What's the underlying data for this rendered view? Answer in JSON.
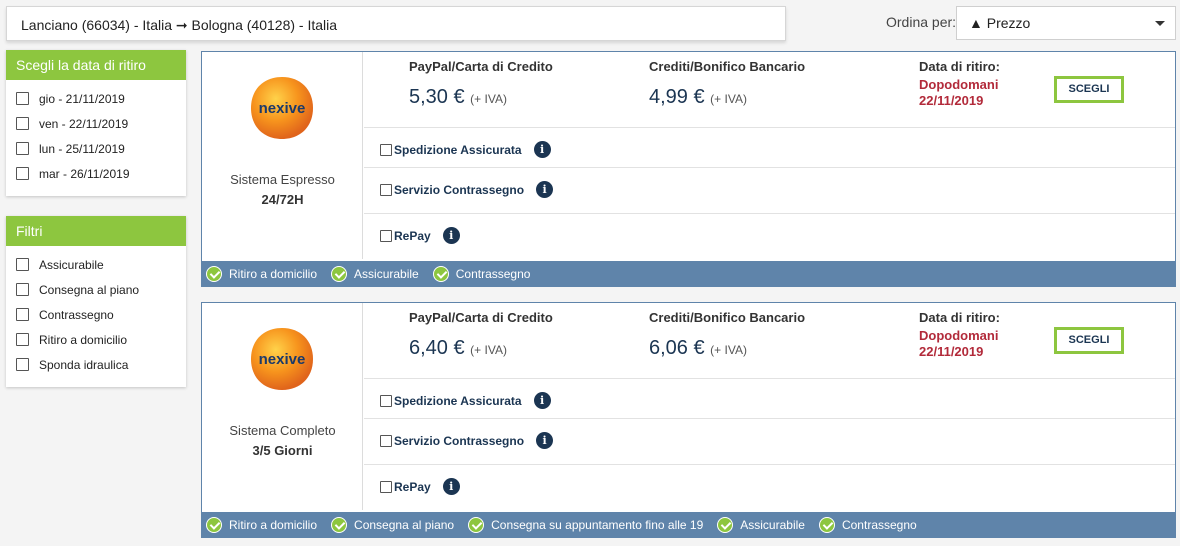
{
  "header": {
    "route": "Lanciano (66034) - Italia ➞ Bologna (40128) - Italia",
    "sort_label": "Ordina per:",
    "sort_value": "▲ Prezzo"
  },
  "date_panel": {
    "title": "Scegli la data di ritiro",
    "options": [
      "gio - 21/11/2019",
      "ven - 22/11/2019",
      "lun - 25/11/2019",
      "mar - 26/11/2019"
    ]
  },
  "filter_panel": {
    "title": "Filtri",
    "options": [
      "Assicurabile",
      "Consegna al piano",
      "Contrassegno",
      "Ritiro a domicilio",
      "Sponda idraulica"
    ]
  },
  "colors": {
    "accent_green": "#8dc63f",
    "bar_blue": "#5f84aa",
    "price_navy": "#1b3552",
    "date_red": "#b22a3a"
  },
  "offers": [
    {
      "logo_text": "nexive",
      "service_name": "Sistema Espresso",
      "service_time": "24/72H",
      "paypal_label": "PayPal/Carta di Credito",
      "paypal_price": "5,30 €",
      "paypal_iva": "(+ IVA)",
      "bank_label": "Crediti/Bonifico Bancario",
      "bank_price": "4,99 €",
      "bank_iva": "(+ IVA)",
      "date_label": "Data di ritiro:",
      "date_day": "Dopodomani",
      "date_value": "22/11/2019",
      "button": "SCEGLI",
      "options": [
        "Spedizione Assicurata",
        "Servizio Contrassegno",
        "RePay"
      ],
      "info_icon": "i",
      "features": [
        "Ritiro a domicilio",
        "Assicurabile",
        "Contrassegno"
      ]
    },
    {
      "logo_text": "nexive",
      "service_name": "Sistema Completo",
      "service_time": "3/5 Giorni",
      "paypal_label": "PayPal/Carta di Credito",
      "paypal_price": "6,40 €",
      "paypal_iva": "(+ IVA)",
      "bank_label": "Crediti/Bonifico Bancario",
      "bank_price": "6,06 €",
      "bank_iva": "(+ IVA)",
      "date_label": "Data di ritiro:",
      "date_day": "Dopodomani",
      "date_value": "22/11/2019",
      "button": "SCEGLI",
      "options": [
        "Spedizione Assicurata",
        "Servizio Contrassegno",
        "RePay"
      ],
      "info_icon": "i",
      "features": [
        "Ritiro a domicilio",
        "Consegna al piano",
        "Consegna su appuntamento fino alle 19",
        "Assicurabile",
        "Contrassegno"
      ]
    }
  ]
}
